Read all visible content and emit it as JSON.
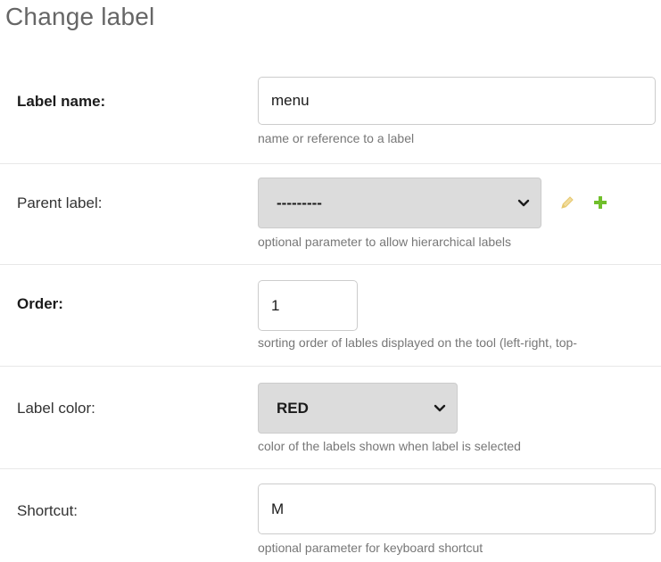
{
  "page": {
    "title": "Change label"
  },
  "fields": {
    "label_name": {
      "label": "Label name:",
      "value": "menu",
      "help": "name or reference to a label"
    },
    "parent_label": {
      "label": "Parent label:",
      "value": "---------",
      "help": "optional parameter to allow hierarchical labels",
      "icons": [
        "pencil-icon",
        "plus-icon"
      ]
    },
    "order": {
      "label": "Order:",
      "value": "1",
      "help": "sorting order of lables displayed on the tool (left-right, top-"
    },
    "label_color": {
      "label": "Label color:",
      "value": "RED",
      "help": "color of the labels shown when label is selected"
    },
    "shortcut": {
      "label": "Shortcut:",
      "value": "M",
      "help": "optional parameter for keyboard shortcut"
    }
  },
  "colors": {
    "select_background": "#dcdcdc",
    "help_text": "#777777",
    "pencil_icon": "#e6c86e",
    "plus_icon": "#70bf2b",
    "row_divider": "#e8e8e8"
  }
}
